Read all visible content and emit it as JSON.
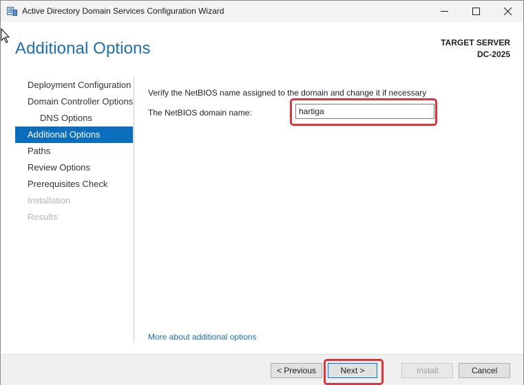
{
  "window": {
    "title": "Active Directory Domain Services Configuration Wizard",
    "controls": {
      "minimize": "minimize",
      "maximize": "maximize",
      "close": "close"
    }
  },
  "header": {
    "page_title": "Additional Options",
    "target_label": "TARGET SERVER",
    "target_name": "DC-2025"
  },
  "nav": {
    "items": [
      {
        "label": "Deployment Configuration",
        "state": "normal"
      },
      {
        "label": "Domain Controller Options",
        "state": "normal"
      },
      {
        "label": "DNS Options",
        "state": "normal"
      },
      {
        "label": "Additional Options",
        "state": "active"
      },
      {
        "label": "Paths",
        "state": "normal"
      },
      {
        "label": "Review Options",
        "state": "normal"
      },
      {
        "label": "Prerequisites Check",
        "state": "normal"
      },
      {
        "label": "Installation",
        "state": "disabled"
      },
      {
        "label": "Results",
        "state": "disabled"
      }
    ]
  },
  "content": {
    "instruction": "Verify the NetBIOS name assigned to the domain and change it if necessary",
    "netbios_label": "The NetBIOS domain name:",
    "netbios_value": "hartiga",
    "more_link": "More about additional options"
  },
  "footer": {
    "previous": "< Previous",
    "next": "Next >",
    "install": "Install",
    "cancel": "Cancel"
  },
  "colors": {
    "accent": "#1f6fad",
    "nav_active": "#0a6ebd",
    "highlight": "#d8363f"
  }
}
